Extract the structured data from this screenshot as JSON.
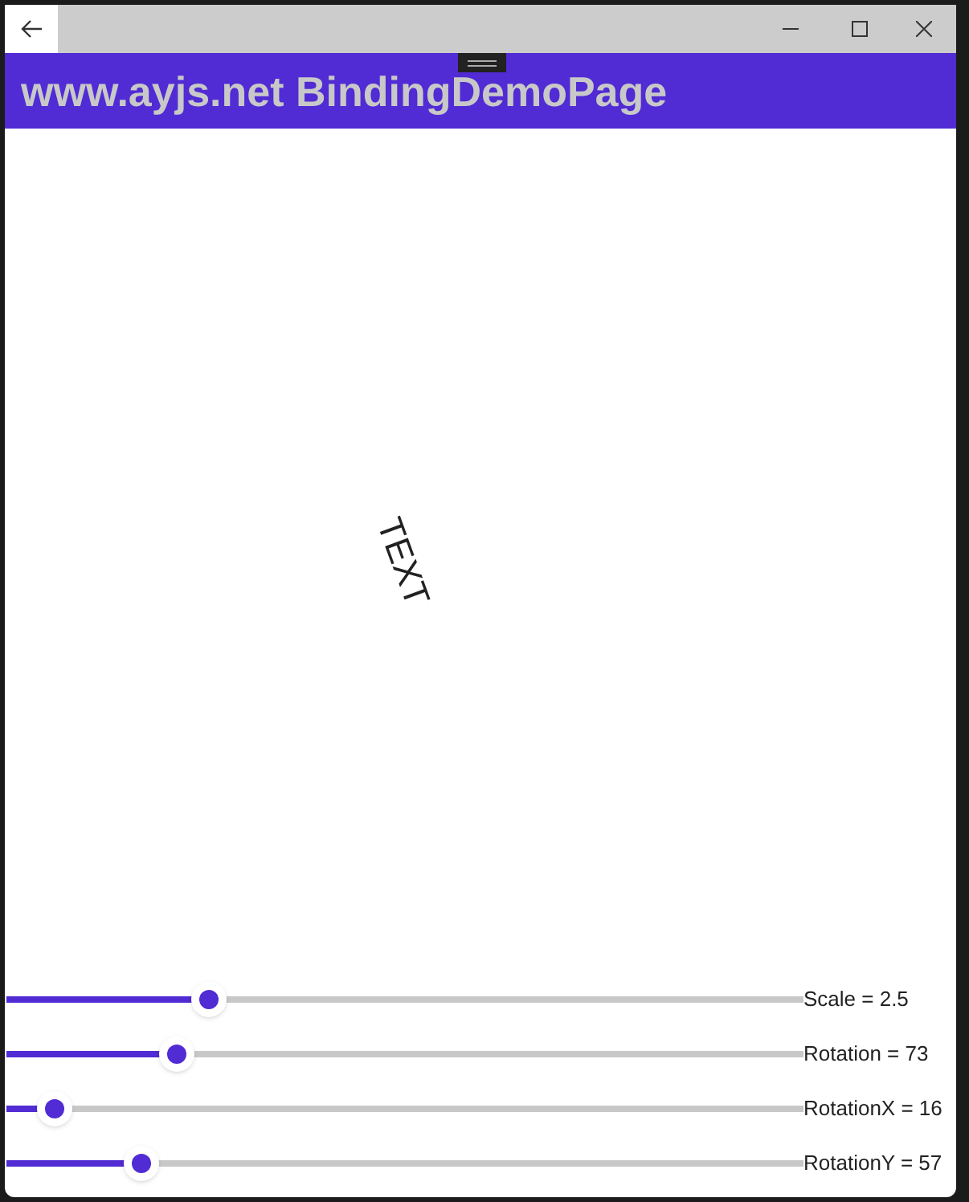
{
  "header": {
    "title": "www.ayjs.net BindingDemoPage"
  },
  "content": {
    "text": "TEXT"
  },
  "sliders": [
    {
      "label": "Scale = 2.5",
      "level": 0.255
    },
    {
      "label": "Rotation = 73",
      "level": 0.214
    },
    {
      "label": "RotationX = 16",
      "level": 0.061
    },
    {
      "label": "RotationY = 57",
      "level": 0.17
    }
  ]
}
